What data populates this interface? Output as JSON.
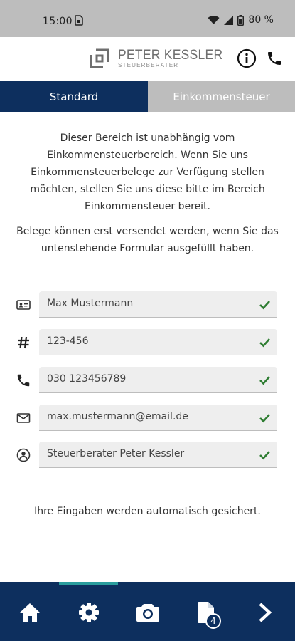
{
  "status_bar": {
    "time": "15:00",
    "sim_icon": "sim-icon",
    "battery_text": "80 %"
  },
  "header": {
    "logo_name": "PETER KESSLER",
    "logo_subtitle": "STEUERBERATER",
    "info_icon": "info-icon",
    "phone_icon": "phone-icon"
  },
  "tabs": [
    {
      "label": "Standard",
      "active": true
    },
    {
      "label": "Einkommensteuer",
      "active": false
    }
  ],
  "intro": {
    "paragraph1": "Dieser Bereich ist unabhängig vom Einkommensteuerbereich. Wenn Sie uns Einkommensteuerbelege zur Verfügung stellen möchten, stellen Sie uns diese bitte im Bereich Einkommensteuer bereit.",
    "paragraph2": "Belege können erst versendet werden, wenn Sie das untenstehende Formular ausgefüllt haben."
  },
  "form": {
    "fields": [
      {
        "icon": "id-card-icon",
        "value": "Max Mustermann"
      },
      {
        "icon": "hash-icon",
        "value": "123-456"
      },
      {
        "icon": "phone-icon",
        "value": "030 123456789"
      },
      {
        "icon": "mail-icon",
        "value": "max.mustermann@email.de"
      },
      {
        "icon": "user-circle-icon",
        "value": "Steuerberater Peter Kessler"
      }
    ]
  },
  "autosave_note": "Ihre Eingaben werden automatisch gesichert.",
  "bottom_nav": {
    "items": [
      "home-icon",
      "settings-icon",
      "camera-icon",
      "documents-icon",
      "next-icon"
    ],
    "documents_badge": "4"
  },
  "colors": {
    "primary": "#0d2f5e",
    "inactive_tab": "#bdbdbd",
    "check": "#2e7d32",
    "indicator": "#2a9d9d"
  }
}
